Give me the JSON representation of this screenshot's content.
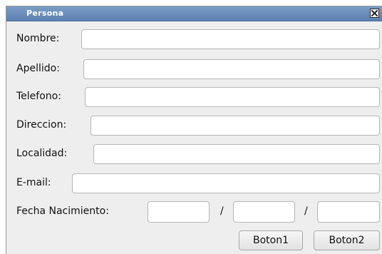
{
  "window": {
    "title": "Persona",
    "close_icon": "close-icon"
  },
  "form": {
    "nombre": {
      "label": "Nombre:",
      "value": "",
      "placeholder": ""
    },
    "apellido": {
      "label": "Apellido:",
      "value": "",
      "placeholder": ""
    },
    "telefono": {
      "label": "Telefono:",
      "value": "",
      "placeholder": ""
    },
    "direccion": {
      "label": "Direccion:",
      "value": "",
      "placeholder": ""
    },
    "localidad": {
      "label": "Localidad:",
      "value": "",
      "placeholder": ""
    },
    "email": {
      "label": "E-mail:",
      "value": "",
      "placeholder": ""
    },
    "fecha": {
      "label": "Fecha Nacimiento:",
      "separator": "/",
      "day": "",
      "month": "",
      "year": ""
    }
  },
  "buttons": {
    "boton1": "Boton1",
    "boton2": "Boton2"
  },
  "colors": {
    "titlebar": "#6b8ebd",
    "window_bg": "#eeeeee",
    "input_border": "#b5b5b5"
  }
}
